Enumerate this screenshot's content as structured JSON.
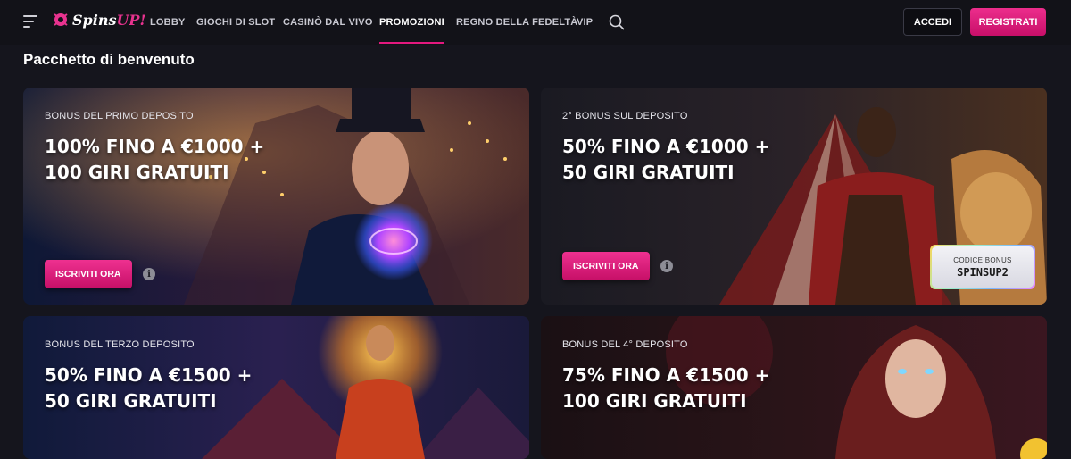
{
  "header": {
    "logo": {
      "white": "Spins",
      "pink": "UP!"
    },
    "nav": [
      {
        "label": "LOBBY",
        "active": false
      },
      {
        "label": "GIOCHI DI SLOT",
        "active": false
      },
      {
        "label": "CASINÒ DAL VIVO",
        "active": false
      },
      {
        "label": "PROMOZIONI",
        "active": true
      },
      {
        "label": "REGNO DELLA FEDELTÀ",
        "active": false
      },
      {
        "label": "VIP",
        "active": false
      }
    ],
    "login_label": "ACCEDI",
    "register_label": "REGISTRATI"
  },
  "section_title": "Pacchetto di benvenuto",
  "cards": [
    {
      "label": "BONUS DEL PRIMO DEPOSITO",
      "line1": "100% FINO A €1000 +",
      "line2": "100 GIRI GRATUITI",
      "cta": "ISCRIVITI ORA"
    },
    {
      "label": "2° BONUS SUL DEPOSITO",
      "line1": "50% FINO A €1000 +",
      "line2": "50 GIRI GRATUITI",
      "cta": "ISCRIVITI ORA",
      "promo_label": "CODICE BONUS",
      "promo_code": "SPINSUP2"
    },
    {
      "label": "BONUS DEL TERZO DEPOSITO",
      "line1": "50% FINO A €1500 +",
      "line2": "50 GIRI GRATUITI"
    },
    {
      "label": "BONUS DEL 4° DEPOSITO",
      "line1": "75% FINO A €1500 +",
      "line2": "100 GIRI GRATUITI"
    }
  ],
  "colors": {
    "accent": "#e3187f",
    "background": "#15151d",
    "header": "#121218"
  },
  "icons": [
    "menu-icon",
    "search-icon",
    "info-icon"
  ]
}
